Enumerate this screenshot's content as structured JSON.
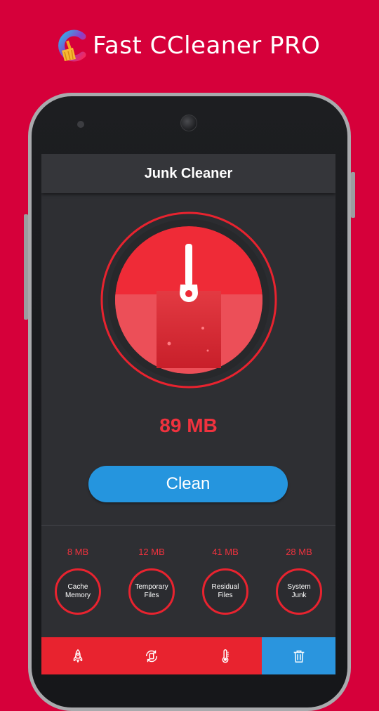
{
  "promo": {
    "title": "Fast CCleaner PRO",
    "logo_icon": "app-logo-broom-icon"
  },
  "app": {
    "title": "Junk Cleaner"
  },
  "gauge": {
    "icon": "broom-icon",
    "accent": "#e8232f"
  },
  "junk_total": "89 MB",
  "clean_button": {
    "label": "Clean",
    "color": "#2595de"
  },
  "categories": [
    {
      "size": "8 MB",
      "label": "Cache Memory"
    },
    {
      "size": "12 MB",
      "label": "Temporary Files"
    },
    {
      "size": "41 MB",
      "label": "Residual Files"
    },
    {
      "size": "28 MB",
      "label": "System Junk"
    }
  ],
  "bottom_nav": [
    {
      "icon": "rocket-icon",
      "active": false
    },
    {
      "icon": "cpu-refresh-icon",
      "active": false
    },
    {
      "icon": "thermometer-icon",
      "active": false
    },
    {
      "icon": "trash-icon",
      "active": true
    }
  ],
  "colors": {
    "background": "#d6003a",
    "screen": "#2e2f33",
    "accent_red": "#e8232f",
    "accent_blue": "#2595de"
  }
}
